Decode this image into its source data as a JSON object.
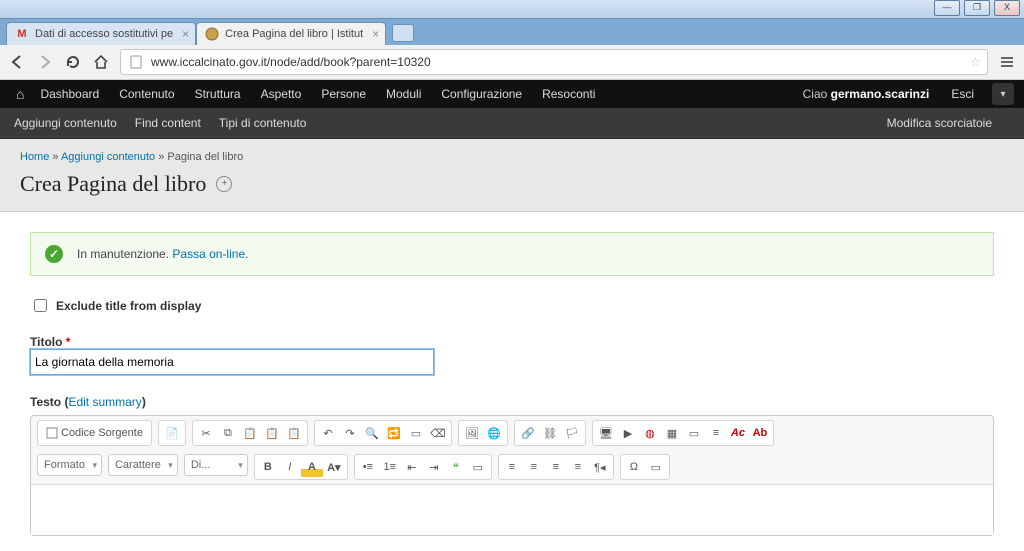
{
  "window": {
    "min": "—",
    "max": "❐",
    "close": "X"
  },
  "tabs": [
    {
      "title": "Dati di accesso sostitutivi pe",
      "icon": "M",
      "active": false
    },
    {
      "title": "Crea Pagina del libro | Istitut",
      "icon": "crest",
      "active": true
    }
  ],
  "omnibox": {
    "url": "www.iccalcinato.gov.it/node/add/book?parent=10320"
  },
  "adminbar": {
    "items": [
      "Dashboard",
      "Contenuto",
      "Struttura",
      "Aspetto",
      "Persone",
      "Moduli",
      "Configurazione",
      "Resoconti"
    ],
    "greeting_prefix": "Ciao ",
    "user": "germano.scarinzi",
    "logout": "Esci"
  },
  "adminbar2": {
    "items": [
      "Aggiungi contenuto",
      "Find content",
      "Tipi di contenuto"
    ],
    "shortcut": "Modifica scorciatoie"
  },
  "breadcrumb": {
    "home": "Home",
    "sep": " » ",
    "add": "Aggiungi contenuto",
    "current": "Pagina del libro"
  },
  "page_title": "Crea Pagina del libro",
  "status": {
    "text": "In manutenzione. ",
    "link": "Passa on-line",
    "dot": "."
  },
  "exclude_label": "Exclude title from display",
  "titolo": {
    "label": "Titolo",
    "value": "La giornata della memoria"
  },
  "testo": {
    "label_pre": "Testo (",
    "link": "Edit summary",
    "label_post": ")"
  },
  "ck": {
    "source": "Codice Sorgente",
    "formato": "Formato",
    "carattere": "Carattere",
    "dim": "Di..."
  }
}
